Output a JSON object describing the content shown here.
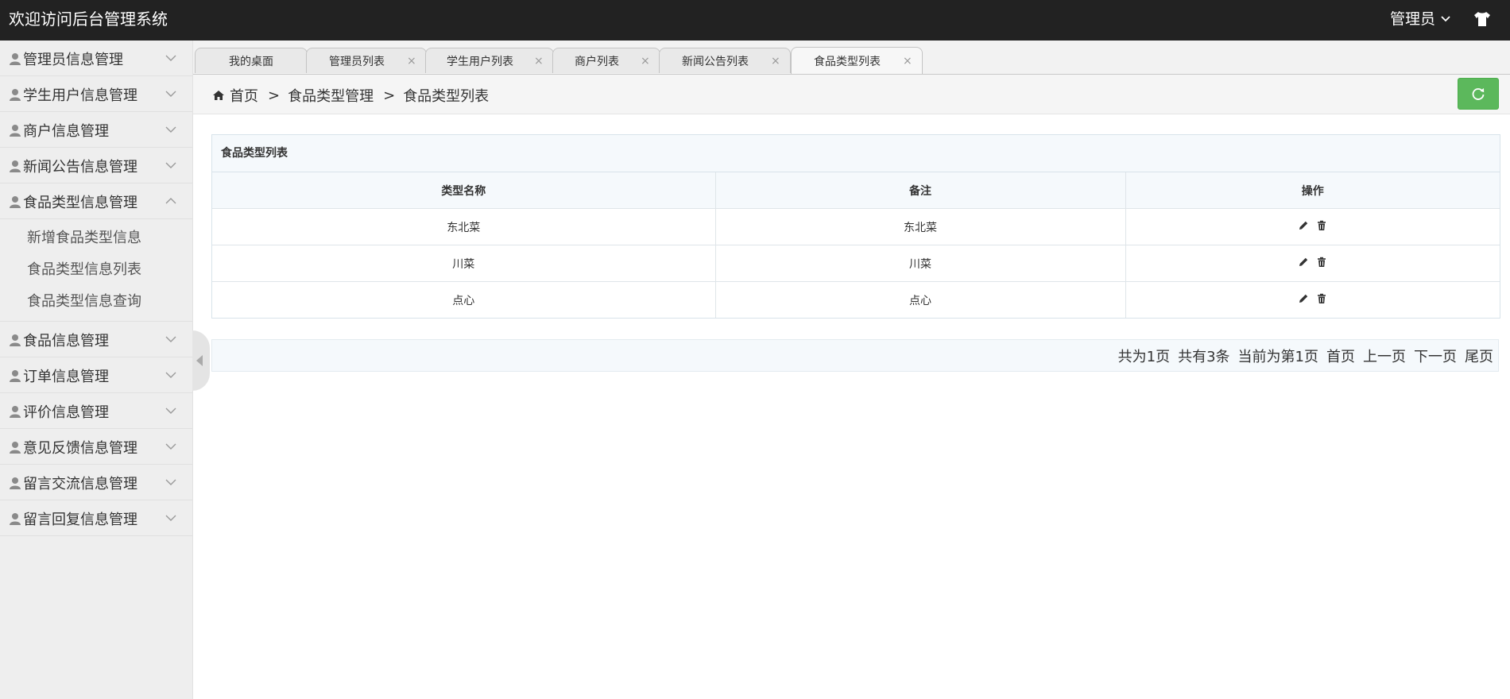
{
  "header": {
    "title": "欢迎访问后台管理系统",
    "user": "管理员"
  },
  "sidebar": {
    "items": [
      {
        "label": "管理员信息管理",
        "expanded": false
      },
      {
        "label": "学生用户信息管理",
        "expanded": false
      },
      {
        "label": "商户信息管理",
        "expanded": false
      },
      {
        "label": "新闻公告信息管理",
        "expanded": false
      },
      {
        "label": "食品类型信息管理",
        "expanded": true
      },
      {
        "label": "食品信息管理",
        "expanded": false
      },
      {
        "label": "订单信息管理",
        "expanded": false
      },
      {
        "label": "评价信息管理",
        "expanded": false
      },
      {
        "label": "意见反馈信息管理",
        "expanded": false
      },
      {
        "label": "留言交流信息管理",
        "expanded": false
      },
      {
        "label": "留言回复信息管理",
        "expanded": false
      }
    ],
    "submenu": [
      "新增食品类型信息",
      "食品类型信息列表",
      "食品类型信息查询"
    ]
  },
  "tabs": [
    {
      "label": "我的桌面",
      "closable": false
    },
    {
      "label": "管理员列表",
      "closable": true
    },
    {
      "label": "学生用户列表",
      "closable": true
    },
    {
      "label": "商户列表",
      "closable": true
    },
    {
      "label": "新闻公告列表",
      "closable": true
    },
    {
      "label": "食品类型列表",
      "closable": true,
      "active": true
    }
  ],
  "tab_close_glyph": "×",
  "breadcrumb": {
    "home": "首页",
    "sep": ">",
    "level1": "食品类型管理",
    "level2": "食品类型列表"
  },
  "table": {
    "title": "食品类型列表",
    "headers": [
      "类型名称",
      "备注",
      "操作"
    ],
    "rows": [
      {
        "name": "东北菜",
        "remark": "东北菜"
      },
      {
        "name": "川菜",
        "remark": "川菜"
      },
      {
        "name": "点心",
        "remark": "点心"
      }
    ]
  },
  "pager": {
    "total_pages": "共为1页",
    "total_records": "共有3条",
    "current": "当前为第1页",
    "first": "首页",
    "prev": "上一页",
    "next": "下一页",
    "last": "尾页"
  },
  "colors": {
    "header_bg": "#222222",
    "sidebar_bg": "#eeeeee",
    "refresh_btn": "#5cb85c"
  },
  "icons": {
    "user": "user-icon",
    "chevron": "chevron-down-icon",
    "shirt": "shirt-icon",
    "home": "home-icon",
    "refresh": "refresh-icon",
    "edit": "pencil-icon",
    "delete": "trash-icon"
  }
}
